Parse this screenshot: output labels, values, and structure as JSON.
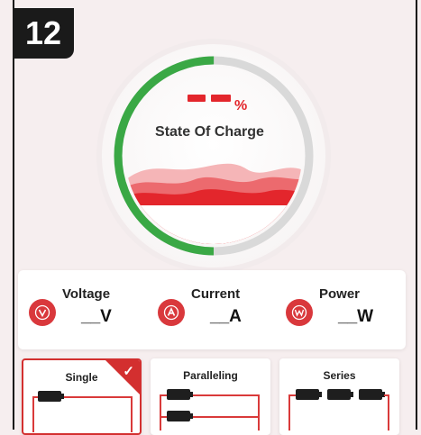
{
  "step": {
    "number": "12"
  },
  "soc": {
    "value": "– –",
    "unit": "%",
    "label": "State Of Charge",
    "arc_fill_fraction": 0.5,
    "colors": {
      "arc": "#3aa845",
      "track": "#d9d9d9",
      "wave": "#e3262c"
    }
  },
  "metrics": [
    {
      "label": "Voltage",
      "value": "__V",
      "icon": "voltage-icon"
    },
    {
      "label": "Current",
      "value": "__A",
      "icon": "current-icon"
    },
    {
      "label": "Power",
      "value": "__W",
      "icon": "power-icon"
    }
  ],
  "modes": [
    {
      "label": "Single",
      "selected": true
    },
    {
      "label": "Paralleling",
      "selected": false
    },
    {
      "label": "Series",
      "selected": false
    }
  ],
  "colors": {
    "accent": "#d32f2f",
    "background": "#f6eeef",
    "card": "#ffffff"
  }
}
